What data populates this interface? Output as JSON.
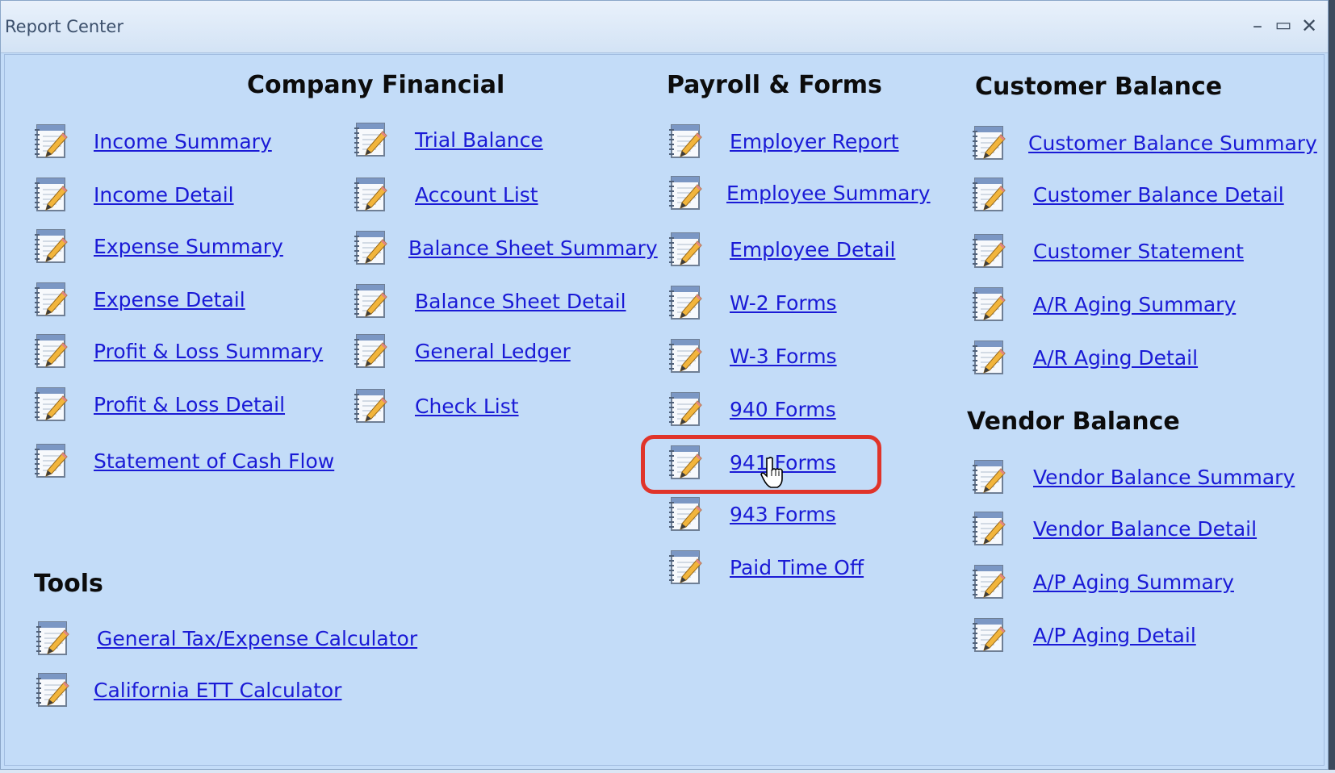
{
  "window": {
    "title": "Report Center",
    "controls": {
      "minimize": "–",
      "maximize": "▭",
      "close": "✕"
    }
  },
  "sections": {
    "company_financial": {
      "heading": "Company Financial",
      "col1": [
        "Income Summary",
        "Income Detail",
        "Expense Summary",
        "Expense Detail",
        "Profit & Loss Summary",
        "Profit & Loss Detail",
        "Statement of Cash Flow"
      ],
      "col2": [
        "Trial Balance",
        "Account List",
        "Balance Sheet Summary",
        "Balance Sheet Detail",
        "General Ledger",
        "Check List"
      ]
    },
    "payroll_forms": {
      "heading": "Payroll & Forms",
      "items": [
        "Employer Report",
        "Employee Summary",
        "Employee Detail",
        "W-2 Forms",
        "W-3 Forms",
        "940 Forms",
        "941 Forms",
        "943 Forms",
        "Paid Time Off"
      ]
    },
    "customer_balance": {
      "heading": "Customer Balance",
      "items": [
        "Customer Balance Summary",
        "Customer Balance Detail",
        "Customer Statement",
        "A/R Aging Summary",
        "A/R Aging Detail"
      ]
    },
    "vendor_balance": {
      "heading": "Vendor Balance",
      "items": [
        "Vendor Balance Summary",
        "Vendor Balance Detail",
        "A/P Aging Summary",
        "A/P Aging Detail"
      ]
    },
    "tools": {
      "heading": "Tools",
      "items": [
        "General Tax/Expense Calculator",
        "California ETT Calculator"
      ]
    }
  },
  "highlighted_item": "941 Forms",
  "icon": "report-notepad-icon",
  "colors": {
    "link": "#1a1ad6",
    "highlight": "#e0342a",
    "background": "#c3dcf8"
  }
}
